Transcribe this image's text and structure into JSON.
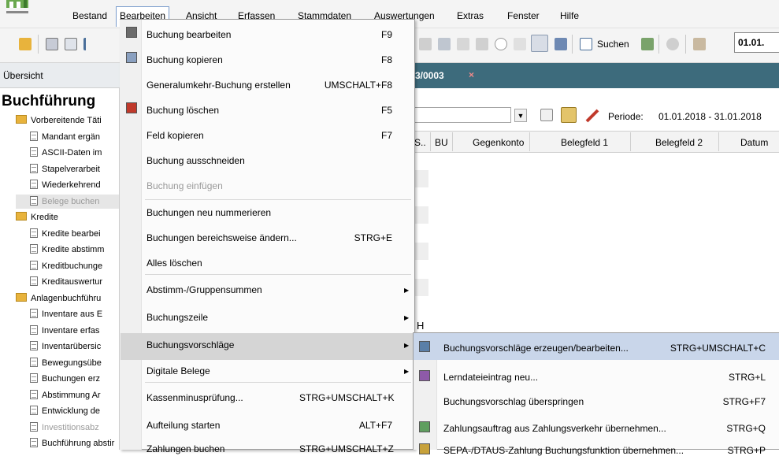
{
  "menubar": {
    "items": [
      "Bestand",
      "Bearbeiten",
      "Ansicht",
      "Erfassen",
      "Stammdaten",
      "Auswertungen",
      "Extras",
      "Fenster",
      "Hilfe"
    ],
    "open_item": "Bearbeiten"
  },
  "toolbar": {
    "search_label": "Suchen",
    "date_value": "01.01."
  },
  "tab": {
    "overview_label": "Übersicht",
    "doc_title": "3/0003",
    "close_glyph": "×"
  },
  "sidebar": {
    "heading": "Buchführung",
    "tree": [
      {
        "label": "Vorbereitende Täti",
        "type": "folder"
      },
      {
        "label": "Mandant ergän",
        "type": "doc"
      },
      {
        "label": "ASCII-Daten im",
        "type": "doc"
      },
      {
        "label": "Stapelverarbeit",
        "type": "doc"
      },
      {
        "label": "Wiederkehrend",
        "type": "doc"
      },
      {
        "label": "Belege buchen",
        "type": "doc-grey"
      },
      {
        "label": "Kredite",
        "type": "folder"
      },
      {
        "label": "Kredite bearbei",
        "type": "doc"
      },
      {
        "label": "Kredite abstimm",
        "type": "doc"
      },
      {
        "label": "Kreditbuchunge",
        "type": "doc"
      },
      {
        "label": "Kreditauswertur",
        "type": "doc"
      },
      {
        "label": "Anlagenbuchführu",
        "type": "folder"
      },
      {
        "label": "Inventare aus E",
        "type": "doc"
      },
      {
        "label": "Inventare erfas",
        "type": "doc"
      },
      {
        "label": "Inventarübersic",
        "type": "doc"
      },
      {
        "label": "Bewegungsübe",
        "type": "doc"
      },
      {
        "label": "Buchungen erz",
        "type": "doc"
      },
      {
        "label": "Abstimmung Ar",
        "type": "doc"
      },
      {
        "label": "Entwicklung de",
        "type": "doc"
      },
      {
        "label": "Investitionsabz",
        "type": "doc-grey"
      },
      {
        "label": "Buchführung abstir",
        "type": "doc"
      }
    ]
  },
  "main": {
    "periode_label": "Periode:",
    "periode_value": "01.01.2018 - 31.01.2018",
    "columns": [
      "S..",
      "BU",
      "Gegenkonto",
      "Belegfeld 1",
      "Belegfeld 2",
      "Datum"
    ],
    "partial_letter": "H"
  },
  "dropdown": {
    "items": [
      {
        "label": "Buchung bearbeiten",
        "shortcut": "F9",
        "icon": "edit-icon"
      },
      {
        "label": "Buchung kopieren",
        "shortcut": "F8",
        "icon": "copy-icon"
      },
      {
        "label": "Generalumkehr-Buchung erstellen",
        "shortcut": "UMSCHALT+F8"
      },
      {
        "label": "Buchung löschen",
        "shortcut": "F5",
        "icon": "delete-icon"
      },
      {
        "label": "Feld kopieren",
        "shortcut": "F7"
      },
      {
        "label": "Buchung ausschneiden",
        "shortcut": ""
      },
      {
        "label": "Buchung einfügen",
        "shortcut": "",
        "disabled": true
      },
      {
        "label": "Buchungen neu nummerieren",
        "shortcut": ""
      },
      {
        "label": "Buchungen bereichsweise ändern...",
        "shortcut": "STRG+E"
      },
      {
        "label": "Alles löschen",
        "shortcut": ""
      },
      {
        "label": "Abstimm-/Gruppensummen",
        "shortcut": "",
        "submenu": true
      },
      {
        "label": "Buchungszeile",
        "shortcut": "",
        "submenu": true
      },
      {
        "label": "Buchungsvorschläge",
        "shortcut": "",
        "submenu": true,
        "active": true
      },
      {
        "label": "Digitale Belege",
        "shortcut": "",
        "submenu": true
      },
      {
        "label": "Kassenminusprüfung...",
        "shortcut": "STRG+UMSCHALT+K"
      },
      {
        "label": "Aufteilung starten",
        "shortcut": "ALT+F7"
      },
      {
        "label": "Zahlungen buchen",
        "shortcut": "STRG+UMSCHALT+Z"
      }
    ]
  },
  "submenu": {
    "items": [
      {
        "label": "Buchungsvorschläge erzeugen/bearbeiten...",
        "shortcut": "STRG+UMSCHALT+C",
        "icon": "proposal-icon"
      },
      {
        "label": "Lerndateieintrag neu...",
        "shortcut": "STRG+L",
        "icon": "learn-entry-icon"
      },
      {
        "label": "Buchungsvorschlag überspringen",
        "shortcut": "STRG+F7"
      },
      {
        "label": "Zahlungsauftrag aus Zahlungsverkehr übernehmen...",
        "shortcut": "STRG+Q",
        "icon": "payment-icon"
      },
      {
        "label": "SEPA-/DTAUS-Zahlung Buchungsfunktion übernehmen...",
        "shortcut": "STRG+P",
        "icon": "sepa-icon"
      }
    ]
  },
  "colors": {
    "tab_dark": "#3d6b7c",
    "highlight_submenu": "#c9d6ea",
    "folder": "#e8b33c"
  }
}
